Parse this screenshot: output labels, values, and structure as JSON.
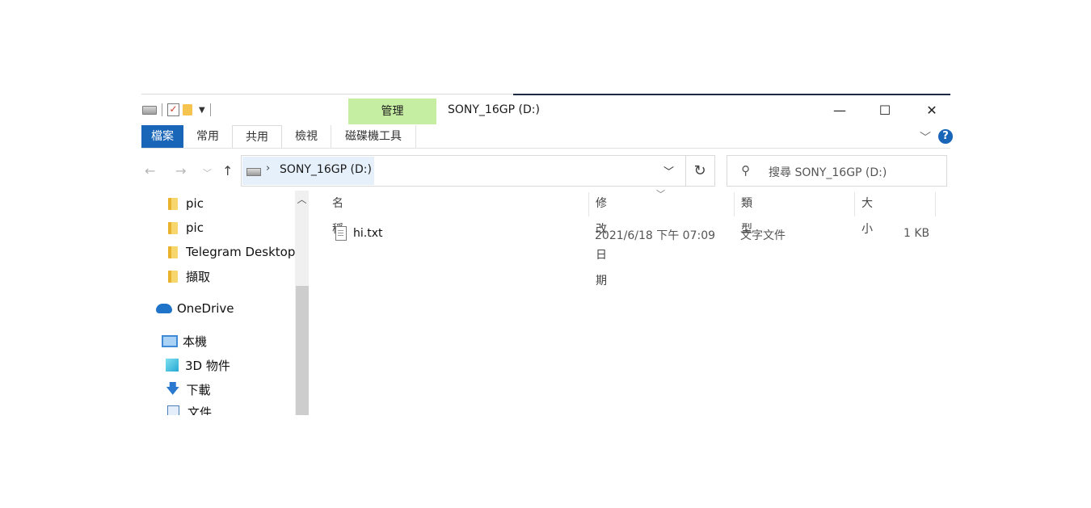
{
  "window": {
    "title": "SONY_16GP (D:)",
    "manage_tab": "管理",
    "buttons": {
      "minimize": "—",
      "maximize": "☐",
      "close": "✕"
    }
  },
  "ribbon": {
    "tabs": [
      "檔案",
      "常用",
      "共用",
      "檢視",
      "磁碟機工具"
    ],
    "help": "?"
  },
  "address": {
    "path": "SONY_16GP (D:)",
    "search_placeholder": "搜尋 SONY_16GP (D:)"
  },
  "nav": {
    "items": [
      "pic",
      "pic",
      "Telegram Desktop",
      "擷取",
      "OneDrive",
      "本機",
      "3D 物件",
      "下載",
      "文件"
    ]
  },
  "columns": [
    "名稱",
    "修改日期",
    "類型",
    "大小"
  ],
  "files": [
    {
      "name": "hi.txt",
      "modified": "2021/6/18 下午 07:09",
      "type": "文字文件",
      "size": "1 KB"
    }
  ],
  "colors": {
    "file_tab": "#1966b8",
    "manage_bg": "#c6eea2",
    "address_highlight": "#e5f0fb"
  }
}
